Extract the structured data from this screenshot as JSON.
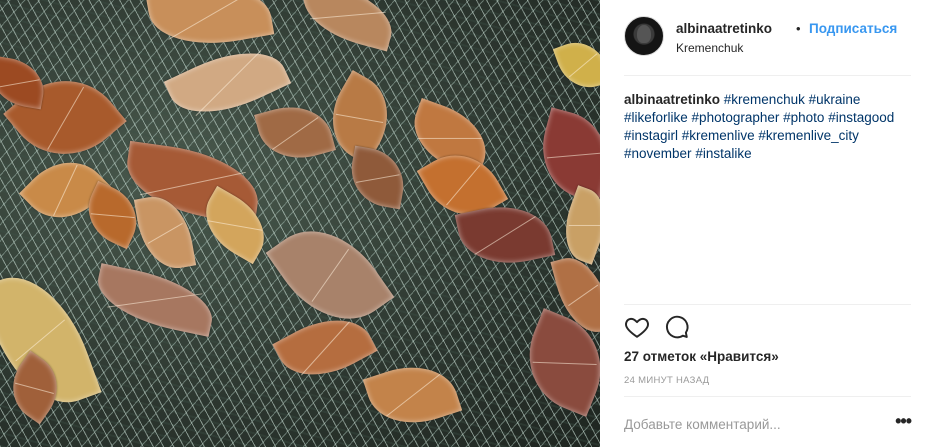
{
  "post": {
    "image_alt": "Frost-covered autumn leaves on grass",
    "author": {
      "username": "albinaatretinko",
      "separator": "•",
      "follow_label": "Подписаться",
      "location": "Kremenchuk"
    },
    "caption": {
      "username": "albinaatretinko",
      "hashtags": [
        "#kremenchuk",
        "#ukraine",
        "#likeforlike",
        "#photographer",
        "#photo",
        "#instagood",
        "#instagirl",
        "#kremenlive",
        "#kremenlive_city",
        "#november",
        "#instalike"
      ]
    },
    "actions": {
      "like_icon": "heart-icon",
      "comment_icon": "comment-bubble-icon"
    },
    "likes_text": "27 отметок «Нравится»",
    "timestamp": "24 МИНУТ НАЗАД",
    "comment": {
      "placeholder": "Добавьте комментарий...",
      "more_icon": "•••"
    }
  },
  "colors": {
    "link": "#3897f0",
    "hashtag": "#003569",
    "text": "#262626",
    "muted": "#999999",
    "divider": "#efefef"
  }
}
